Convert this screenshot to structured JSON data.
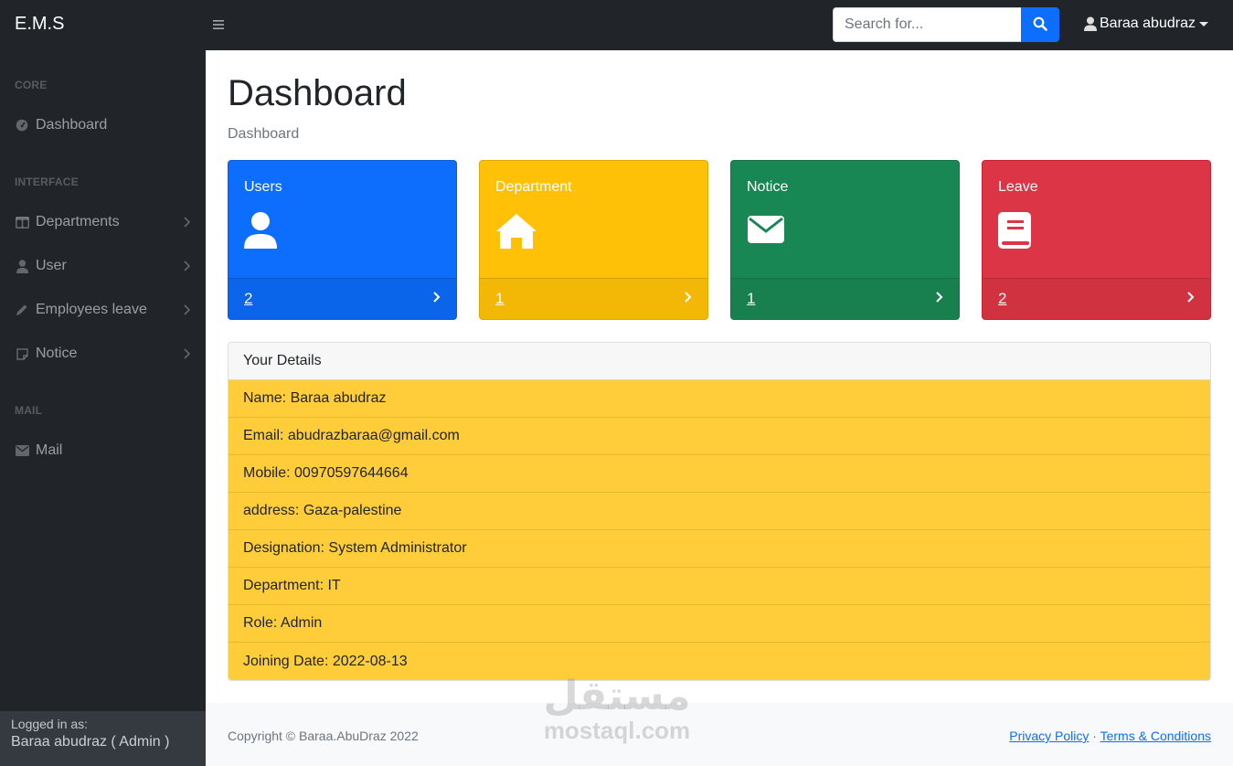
{
  "navbar": {
    "brand": "E.M.S",
    "search_placeholder": "Search for...",
    "user_name": "Baraa abudraz"
  },
  "sidebar": {
    "headings": {
      "core": "CORE",
      "interface": "INTERFACE",
      "mail": "MAIL"
    },
    "items": {
      "dashboard": "Dashboard",
      "departments": "Departments",
      "user": "User",
      "employees_leave": "Employees leave",
      "notice": "Notice",
      "mail": "Mail"
    },
    "footer": {
      "label": "Logged in as:",
      "who": "Baraa abudraz ( Admin )"
    }
  },
  "main": {
    "title": "Dashboard",
    "breadcrumb": "Dashboard",
    "cards": {
      "users": {
        "title": "Users",
        "count": "2",
        "icon": "user-icon",
        "color": "#0d6efd"
      },
      "department": {
        "title": "Department",
        "count": "1",
        "icon": "home-icon",
        "color": "#ffc107"
      },
      "notice": {
        "title": "Notice",
        "count": "1",
        "icon": "envelope-icon",
        "color": "#198754"
      },
      "leave": {
        "title": "Leave",
        "count": "2",
        "icon": "book-icon",
        "color": "#dc3545"
      }
    },
    "details": {
      "header": "Your Details",
      "rows": [
        "Name: Baraa abudraz",
        "Email: abudrazbaraa@gmail.com",
        "Mobile: 00970597644664",
        "address: Gaza-palestine",
        "Designation: System Administrator",
        "Department: IT",
        "Role: Admin",
        "Joining Date: 2022-08-13"
      ]
    }
  },
  "footer": {
    "copyright": "Copyright © Baraa.AbuDraz 2022",
    "privacy": "Privacy Policy",
    "separator": "·",
    "terms": "Terms & Conditions"
  },
  "watermark": {
    "arabic": "مستقل",
    "latin": "mostaql.com"
  }
}
